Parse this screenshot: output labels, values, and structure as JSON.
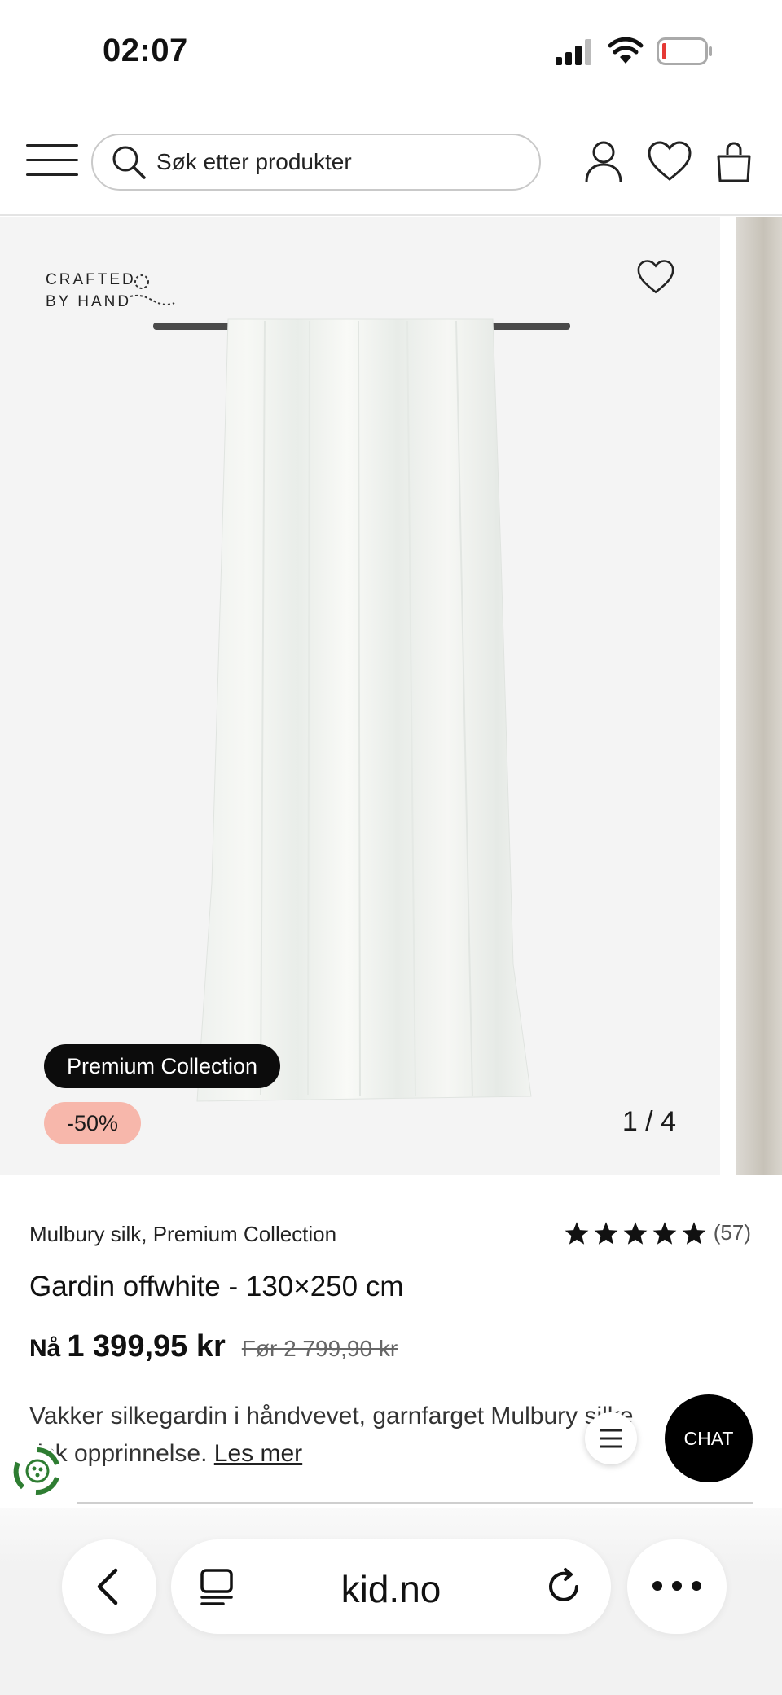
{
  "status_bar": {
    "time": "02:07"
  },
  "header": {
    "search_placeholder": "Søk etter produkter"
  },
  "gallery": {
    "badge_crafted_line1": "CRAFTED",
    "badge_crafted_line2": "BY HAND",
    "premium_label": "Premium Collection",
    "discount_label": "-50%",
    "counter": "1 / 4"
  },
  "product": {
    "brand": "Mulbury silk, Premium Collection",
    "rating_value": 5,
    "rating_count": "(57)",
    "title": "Gardin offwhite - 130×250 cm",
    "price_prefix": "Nå",
    "price_now": "1 399,95 kr",
    "price_before": "Før 2 799,90 kr",
    "description_line1": "Vakker silkegardin i håndvevet, garnfarget Mulbury silke",
    "description_line2": "isk opprinnelse.",
    "read_more": "Les mer"
  },
  "floating": {
    "chat_label": "CHAT"
  },
  "browser": {
    "url": "kid.no"
  },
  "colors": {
    "sale_pill": "#f7b7ab",
    "premium_pill": "#0c0c0c",
    "eco_green": "#2e7d32"
  }
}
